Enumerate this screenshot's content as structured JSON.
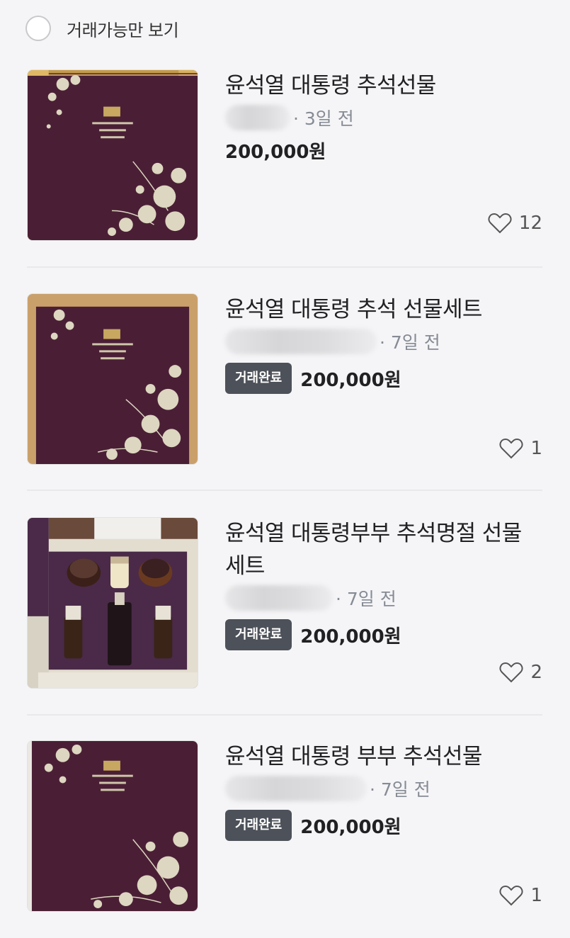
{
  "filter": {
    "label": "거래가능만 보기"
  },
  "items": [
    {
      "title": "윤석열 대통령 추석선물",
      "time": "· 3일 전",
      "badge": "",
      "price": "200,000원",
      "likes": "12"
    },
    {
      "title": "윤석열 대통령 추석 선물세트",
      "time": "· 7일 전",
      "badge": "거래완료",
      "price": "200,000원",
      "likes": "1"
    },
    {
      "title": "윤석열 대통령부부 추석명절 선물세트",
      "time": "· 7일 전",
      "badge": "거래완료",
      "price": "200,000원",
      "likes": "2"
    },
    {
      "title": "윤석열 대통령 부부 추석선물",
      "time": "· 7일 전",
      "badge": "거래완료",
      "price": "200,000원",
      "likes": "1"
    }
  ],
  "colors": {
    "box": "#4a1f35",
    "pattern": "#e8e2d2",
    "badge_bg": "#4d5159"
  },
  "icons": {
    "like": "heart-outline-icon",
    "filter": "radio-circle-icon"
  }
}
